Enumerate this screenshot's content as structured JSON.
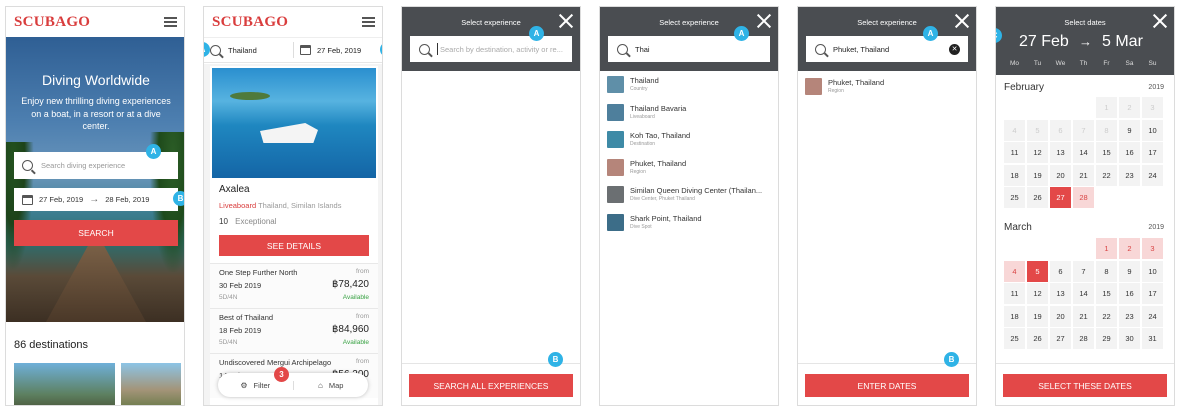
{
  "brand": "SCUBAGO",
  "badges": {
    "a": "A",
    "b": "B",
    "c": "C",
    "three": "3"
  },
  "s1": {
    "hero_title": "Diving Worldwide",
    "hero_text": "Enjoy new thrilling diving experiences on a boat, in a resort or at a dive center.",
    "search_placeholder": "Search diving experience",
    "date_from": "27 Feb, 2019",
    "date_to": "28 Feb, 2019",
    "search_button": "SEARCH",
    "destinations": "86 destinations"
  },
  "s2": {
    "query": "Thailand",
    "date": "27 Feb, 2019",
    "name": "Axalea",
    "type": "Liveaboard",
    "location": "Thailand, Similan Islands",
    "score": "10",
    "score_text": "Exceptional",
    "details_button": "SEE DETAILS",
    "trips": [
      {
        "name": "One Step Further North",
        "from": "from",
        "date": "30 Feb 2019",
        "price": "฿78,420",
        "duration": "5D/4N",
        "status": "Available"
      },
      {
        "name": "Best of Thailand",
        "from": "from",
        "date": "18 Feb 2019",
        "price": "฿84,960",
        "duration": "5D/4N",
        "status": "Available"
      },
      {
        "name": "Undiscovered Mergui Archipelago",
        "from": "from",
        "date": "14 Feb 2019",
        "price": "฿56,200"
      }
    ],
    "filter": "Filter",
    "map": "Map"
  },
  "s3": {
    "header": "Select experience",
    "placeholder": "Search by destination, activity or re...",
    "button": "SEARCH ALL EXPERIENCES"
  },
  "s4": {
    "header": "Select experience",
    "query": "Thai",
    "results": [
      {
        "name": "Thailand",
        "sub": "Country",
        "color": "#5f8fa8"
      },
      {
        "name": "Thailand Bavaria",
        "sub": "Liveaboard",
        "color": "#4e7f9c"
      },
      {
        "name": "Koh Tao, Thailand",
        "sub": "Destination",
        "color": "#3e8aa6"
      },
      {
        "name": "Phuket, Thailand",
        "sub": "Region",
        "color": "#b5857a"
      },
      {
        "name": "Similan Queen Diving Center (Thailan...",
        "sub": "Dive Center, Phuket Thailand",
        "color": "#6b6f72"
      },
      {
        "name": "Shark Point, Thailand",
        "sub": "Dive Spot",
        "color": "#3c6d88"
      }
    ]
  },
  "s5": {
    "header": "Select experience",
    "query": "Phuket, Thailand",
    "result": {
      "name": "Phuket, Thailand",
      "sub": "Region",
      "color": "#b5857a"
    },
    "button": "ENTER DATES"
  },
  "s6": {
    "header": "Select dates",
    "from": "27 Feb",
    "to": "5 Mar",
    "weekdays": [
      "Mo",
      "Tu",
      "We",
      "Th",
      "Fr",
      "Sa",
      "Su"
    ],
    "feb": {
      "name": "February",
      "year": "2019",
      "days": [
        {
          "d": "",
          "s": "empty"
        },
        {
          "d": "",
          "s": "empty"
        },
        {
          "d": "",
          "s": "empty"
        },
        {
          "d": "",
          "s": "empty"
        },
        {
          "d": "1",
          "s": "dis"
        },
        {
          "d": "2",
          "s": "dis"
        },
        {
          "d": "3",
          "s": "dis"
        },
        {
          "d": "4",
          "s": "dis"
        },
        {
          "d": "5",
          "s": "dis"
        },
        {
          "d": "6",
          "s": "dis"
        },
        {
          "d": "7",
          "s": "dis"
        },
        {
          "d": "8",
          "s": "dis"
        },
        {
          "d": "9",
          "s": ""
        },
        {
          "d": "10",
          "s": ""
        },
        {
          "d": "11",
          "s": ""
        },
        {
          "d": "12",
          "s": ""
        },
        {
          "d": "13",
          "s": ""
        },
        {
          "d": "14",
          "s": ""
        },
        {
          "d": "15",
          "s": ""
        },
        {
          "d": "16",
          "s": ""
        },
        {
          "d": "17",
          "s": ""
        },
        {
          "d": "18",
          "s": ""
        },
        {
          "d": "19",
          "s": ""
        },
        {
          "d": "20",
          "s": ""
        },
        {
          "d": "21",
          "s": ""
        },
        {
          "d": "22",
          "s": ""
        },
        {
          "d": "23",
          "s": ""
        },
        {
          "d": "24",
          "s": ""
        },
        {
          "d": "25",
          "s": ""
        },
        {
          "d": "26",
          "s": ""
        },
        {
          "d": "27",
          "s": "sel"
        },
        {
          "d": "28",
          "s": "rng"
        }
      ]
    },
    "mar": {
      "name": "March",
      "year": "2019",
      "days": [
        {
          "d": "",
          "s": "empty"
        },
        {
          "d": "",
          "s": "empty"
        },
        {
          "d": "",
          "s": "empty"
        },
        {
          "d": "",
          "s": "empty"
        },
        {
          "d": "1",
          "s": "rng"
        },
        {
          "d": "2",
          "s": "rng"
        },
        {
          "d": "3",
          "s": "rng"
        },
        {
          "d": "4",
          "s": "rng"
        },
        {
          "d": "5",
          "s": "sel"
        },
        {
          "d": "6",
          "s": ""
        },
        {
          "d": "7",
          "s": ""
        },
        {
          "d": "8",
          "s": ""
        },
        {
          "d": "9",
          "s": ""
        },
        {
          "d": "10",
          "s": ""
        },
        {
          "d": "11",
          "s": ""
        },
        {
          "d": "12",
          "s": ""
        },
        {
          "d": "13",
          "s": ""
        },
        {
          "d": "14",
          "s": ""
        },
        {
          "d": "15",
          "s": ""
        },
        {
          "d": "16",
          "s": ""
        },
        {
          "d": "17",
          "s": ""
        },
        {
          "d": "18",
          "s": ""
        },
        {
          "d": "19",
          "s": ""
        },
        {
          "d": "20",
          "s": ""
        },
        {
          "d": "21",
          "s": ""
        },
        {
          "d": "22",
          "s": ""
        },
        {
          "d": "23",
          "s": ""
        },
        {
          "d": "24",
          "s": ""
        },
        {
          "d": "25",
          "s": ""
        },
        {
          "d": "26",
          "s": ""
        },
        {
          "d": "27",
          "s": ""
        },
        {
          "d": "28",
          "s": ""
        },
        {
          "d": "29",
          "s": ""
        },
        {
          "d": "30",
          "s": ""
        },
        {
          "d": "31",
          "s": ""
        }
      ]
    },
    "button": "SELECT THESE DATES"
  }
}
